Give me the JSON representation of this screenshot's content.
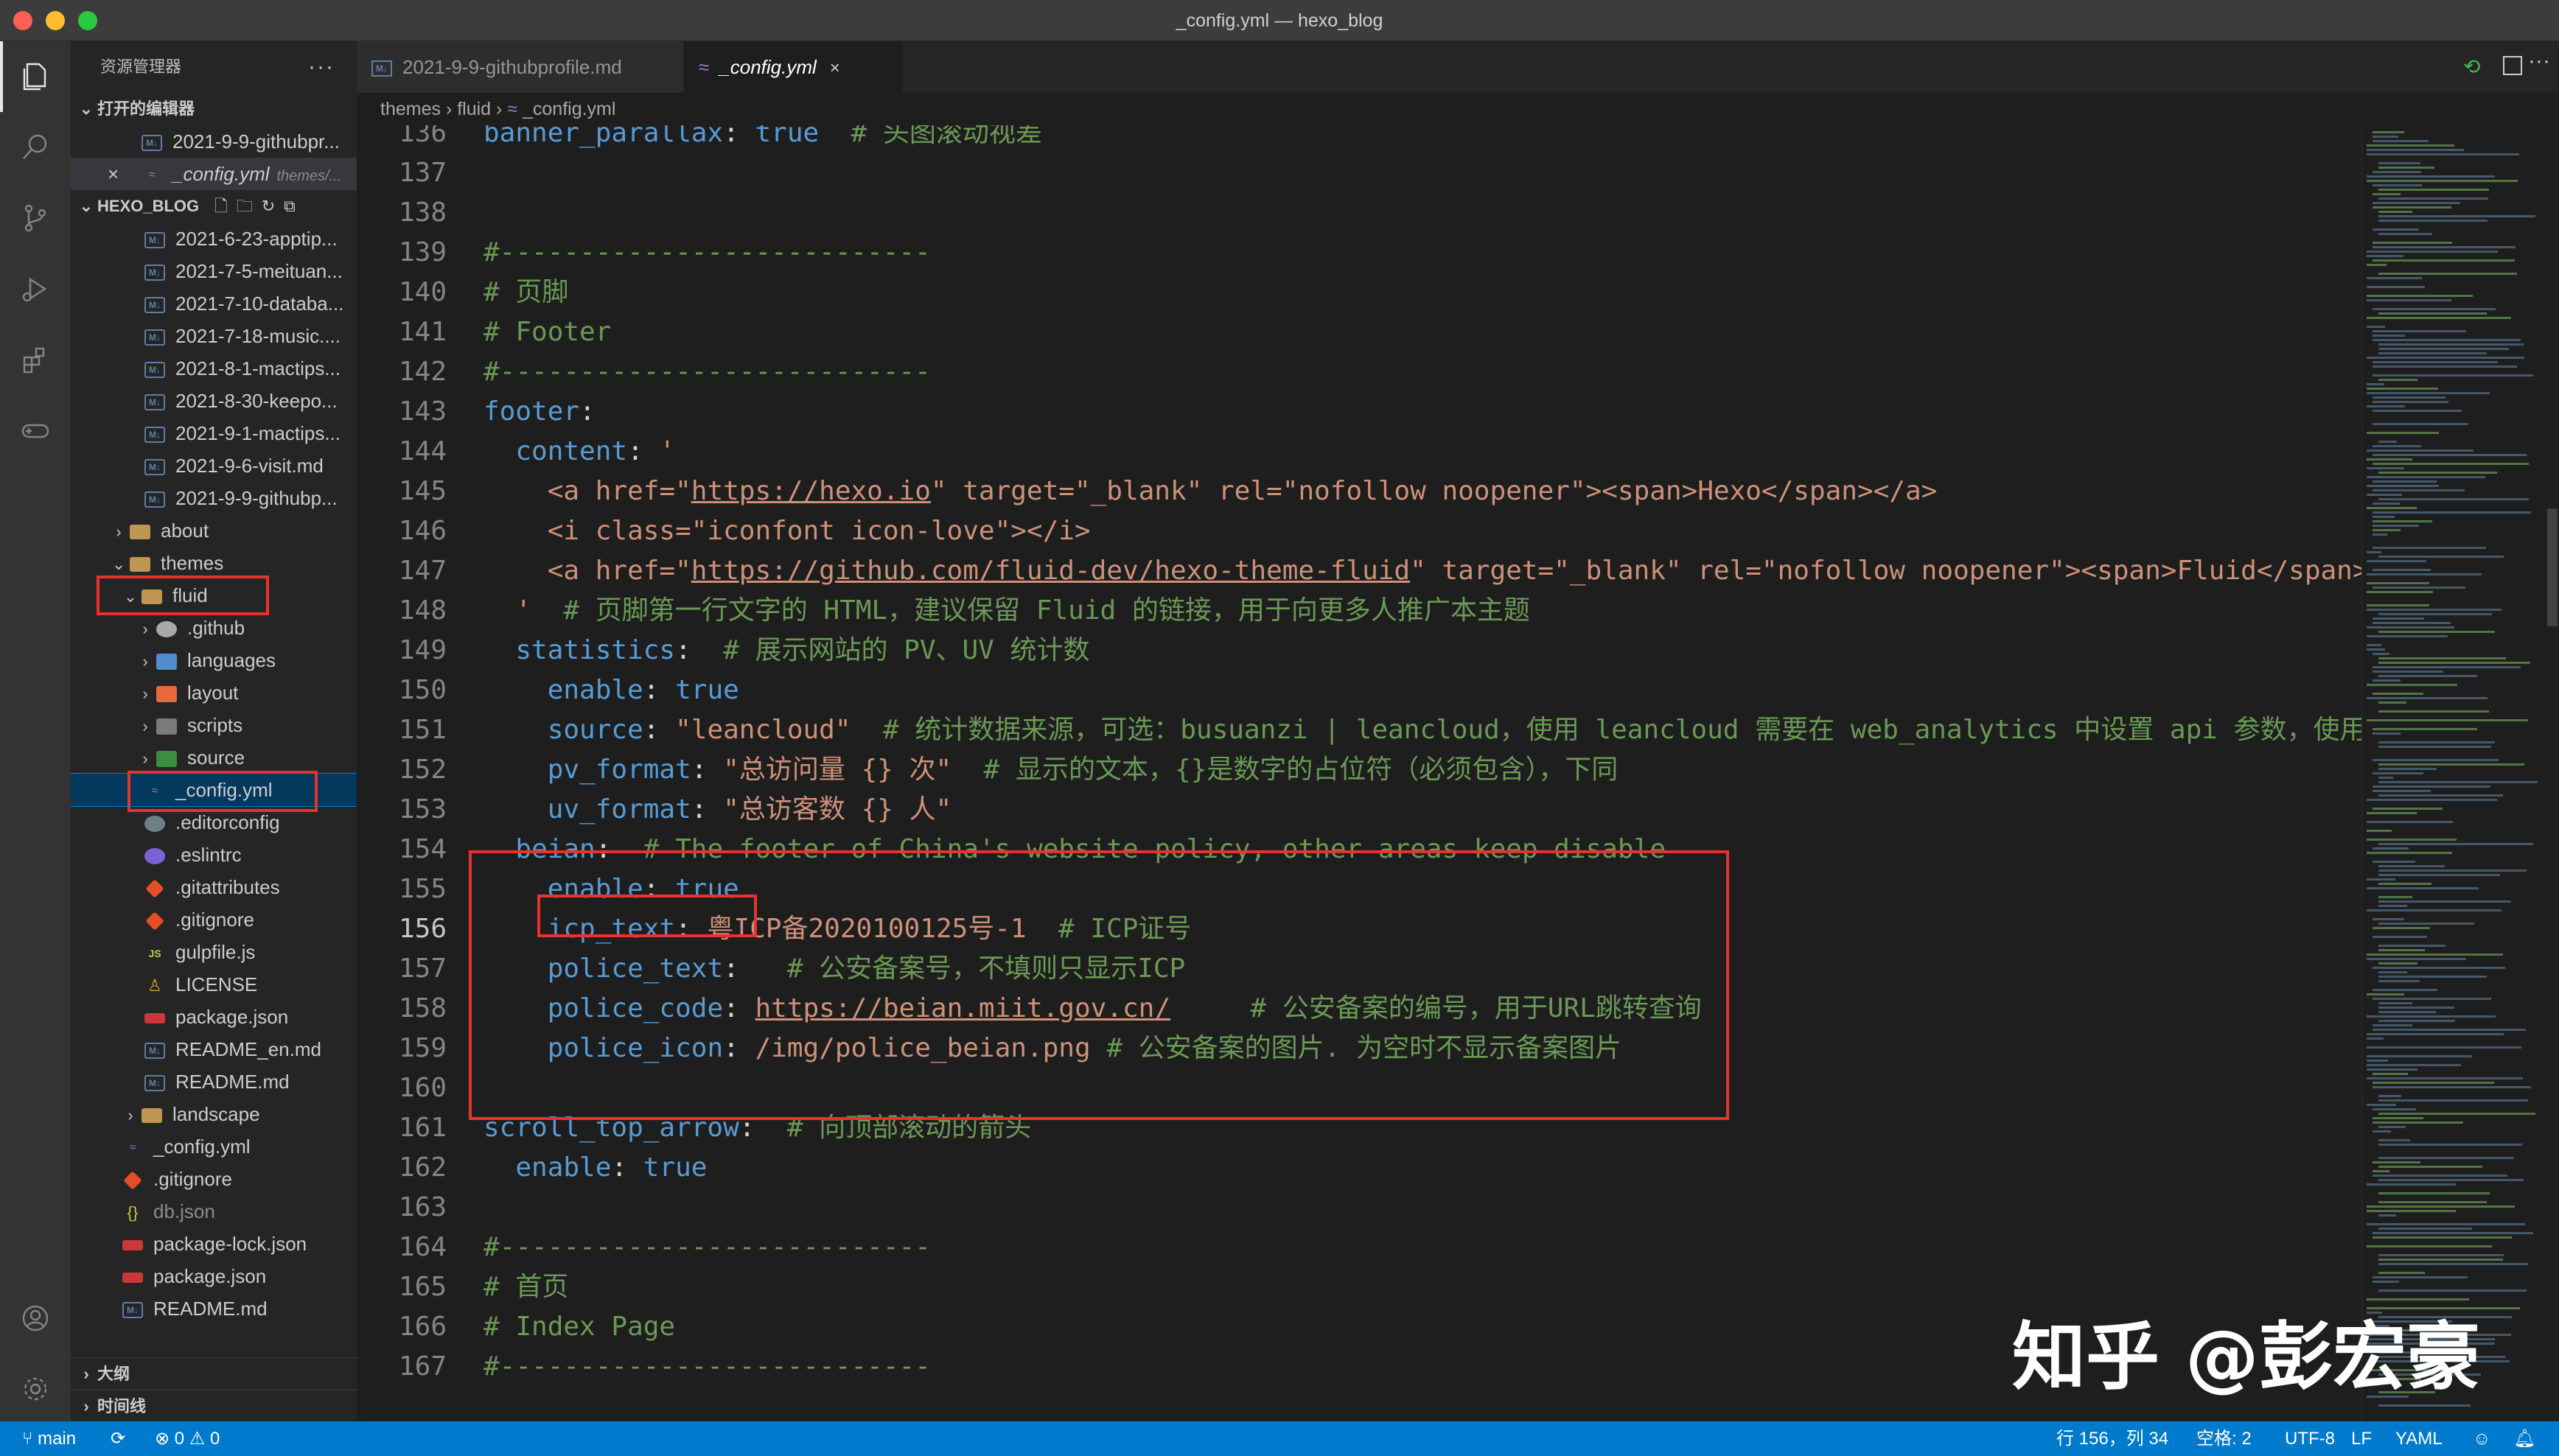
{
  "window": {
    "title": "_config.yml — hexo_blog"
  },
  "sidebar": {
    "title": "资源管理器",
    "open_editors_label": "打开的编辑器",
    "open_editors": [
      {
        "name": "2021-9-9-githubpr...",
        "note": ""
      },
      {
        "name": "_config.yml",
        "note": "themes/..."
      }
    ],
    "project_label": "HEXO_BLOG",
    "files": [
      "2021-6-23-apptip...",
      "2021-7-5-meituan...",
      "2021-7-10-databa...",
      "2021-7-18-music....",
      "2021-8-1-mactips...",
      "2021-8-30-keepo...",
      "2021-9-1-mactips...",
      "2021-9-6-visit.md",
      "2021-9-9-githubp...",
      "about",
      "themes",
      "fluid",
      ".github",
      "languages",
      "layout",
      "scripts",
      "source",
      "_config.yml",
      ".editorconfig",
      ".eslintrc",
      ".gitattributes",
      ".gitignore",
      "gulpfile.js",
      "LICENSE",
      "package.json",
      "README_en.md",
      "README.md",
      "landscape",
      "_config.yml",
      ".gitignore",
      "db.json",
      "package-lock.json",
      "package.json",
      "README.md"
    ],
    "outline_label": "大纲",
    "timeline_label": "时间线"
  },
  "tabs": [
    {
      "label": "2021-9-9-githubprofile.md"
    },
    {
      "label": "_config.yml",
      "close": "×"
    }
  ],
  "breadcrumb": [
    "themes",
    "fluid",
    "_config.yml"
  ],
  "editor": {
    "current_line": 156,
    "lines": [
      {
        "n": "136",
        "t": [
          [
            "k",
            "banner_parallax"
          ],
          [
            "p",
            ": "
          ],
          [
            "b",
            "true"
          ],
          [
            "p",
            "  "
          ],
          [
            "c",
            "# 头图滚动视差"
          ]
        ]
      },
      {
        "n": "137",
        "t": []
      },
      {
        "n": "138",
        "t": []
      },
      {
        "n": "139",
        "t": [
          [
            "c",
            "#---------------------------"
          ]
        ]
      },
      {
        "n": "140",
        "t": [
          [
            "c",
            "# 页脚"
          ]
        ]
      },
      {
        "n": "141",
        "t": [
          [
            "c",
            "# Footer"
          ]
        ]
      },
      {
        "n": "142",
        "t": [
          [
            "c",
            "#---------------------------"
          ]
        ]
      },
      {
        "n": "143",
        "t": [
          [
            "k",
            "footer"
          ],
          [
            "p",
            ":"
          ]
        ]
      },
      {
        "n": "144",
        "t": [
          [
            "p",
            "  "
          ],
          [
            "k",
            "content"
          ],
          [
            "p",
            ": "
          ],
          [
            "s",
            "'"
          ]
        ]
      },
      {
        "n": "145",
        "t": [
          [
            "s",
            "    <a href=\""
          ],
          [
            "u",
            "https://hexo.io"
          ],
          [
            "s",
            "\" target=\"_blank\" rel=\"nofollow noopener\"><span>Hexo</span></a>"
          ]
        ]
      },
      {
        "n": "146",
        "t": [
          [
            "s",
            "    <i class=\"iconfont icon-love\"></i>"
          ]
        ]
      },
      {
        "n": "147",
        "t": [
          [
            "s",
            "    <a href=\""
          ],
          [
            "u",
            "https://github.com/fluid-dev/hexo-theme-fluid"
          ],
          [
            "s",
            "\" target=\"_blank\" rel=\"nofollow noopener\"><span>Fluid</span></a>"
          ]
        ]
      },
      {
        "n": "148",
        "t": [
          [
            "s",
            "  '"
          ],
          [
            "p",
            "  "
          ],
          [
            "c",
            "# 页脚第一行文字的 HTML，建议保留 Fluid 的链接，用于向更多人推广本主题"
          ]
        ]
      },
      {
        "n": "149",
        "t": [
          [
            "p",
            "  "
          ],
          [
            "k",
            "statistics"
          ],
          [
            "p",
            ":  "
          ],
          [
            "c",
            "# 展示网站的 PV、UV 统计数"
          ]
        ]
      },
      {
        "n": "150",
        "t": [
          [
            "p",
            "    "
          ],
          [
            "k",
            "enable"
          ],
          [
            "p",
            ": "
          ],
          [
            "b",
            "true"
          ]
        ]
      },
      {
        "n": "151",
        "t": [
          [
            "p",
            "    "
          ],
          [
            "k",
            "source"
          ],
          [
            "p",
            ": "
          ],
          [
            "s",
            "\"leancloud\""
          ],
          [
            "p",
            "  "
          ],
          [
            "c",
            "# 统计数据来源，可选：busuanzi | leancloud，使用 leancloud 需要在 web_analytics 中设置 api 参数，使用 busuanzi 不需要额外设置"
          ]
        ]
      },
      {
        "n": "152",
        "t": [
          [
            "p",
            "    "
          ],
          [
            "k",
            "pv_format"
          ],
          [
            "p",
            ": "
          ],
          [
            "s",
            "\"总访问量 {} 次\""
          ],
          [
            "p",
            "  "
          ],
          [
            "c",
            "# 显示的文本，{}是数字的占位符（必须包含），下同"
          ]
        ]
      },
      {
        "n": "153",
        "t": [
          [
            "p",
            "    "
          ],
          [
            "k",
            "uv_format"
          ],
          [
            "p",
            ": "
          ],
          [
            "s",
            "\"总访客数 {} 人\""
          ]
        ]
      },
      {
        "n": "154",
        "t": [
          [
            "p",
            "  "
          ],
          [
            "k",
            "beian"
          ],
          [
            "p",
            ":  "
          ],
          [
            "c",
            "# The footer of China's website policy, other areas keep disable"
          ]
        ]
      },
      {
        "n": "155",
        "t": [
          [
            "p",
            "    "
          ],
          [
            "k",
            "enable"
          ],
          [
            "p",
            ": "
          ],
          [
            "b",
            "true"
          ]
        ]
      },
      {
        "n": "156",
        "t": [
          [
            "p",
            "    "
          ],
          [
            "k",
            "icp_text"
          ],
          [
            "p",
            ": "
          ],
          [
            "s",
            "粤ICP备2020100125号-1"
          ],
          [
            "p",
            "  "
          ],
          [
            "c",
            "# ICP证号"
          ]
        ]
      },
      {
        "n": "157",
        "t": [
          [
            "p",
            "    "
          ],
          [
            "k",
            "police_text"
          ],
          [
            "p",
            ":   "
          ],
          [
            "c",
            "# 公安备案号，不填则只显示ICP"
          ]
        ]
      },
      {
        "n": "158",
        "t": [
          [
            "p",
            "    "
          ],
          [
            "k",
            "police_code"
          ],
          [
            "p",
            ": "
          ],
          [
            "u",
            "https://beian.miit.gov.cn/"
          ],
          [
            "p",
            "     "
          ],
          [
            "c",
            "# 公安备案的编号，用于URL跳转查询"
          ]
        ]
      },
      {
        "n": "159",
        "t": [
          [
            "p",
            "    "
          ],
          [
            "k",
            "police_icon"
          ],
          [
            "p",
            ": "
          ],
          [
            "s",
            "/img/police_beian.png"
          ],
          [
            "p",
            " "
          ],
          [
            "c",
            "# 公安备案的图片. 为空时不显示备案图片"
          ]
        ]
      },
      {
        "n": "160",
        "t": []
      },
      {
        "n": "161",
        "t": [
          [
            "k",
            "scroll_top_arrow"
          ],
          [
            "p",
            ":  "
          ],
          [
            "c",
            "# 向顶部滚动的箭头"
          ]
        ]
      },
      {
        "n": "162",
        "t": [
          [
            "p",
            "  "
          ],
          [
            "k",
            "enable"
          ],
          [
            "p",
            ": "
          ],
          [
            "b",
            "true"
          ]
        ]
      },
      {
        "n": "163",
        "t": []
      },
      {
        "n": "164",
        "t": [
          [
            "c",
            "#---------------------------"
          ]
        ]
      },
      {
        "n": "165",
        "t": [
          [
            "c",
            "# 首页"
          ]
        ]
      },
      {
        "n": "166",
        "t": [
          [
            "c",
            "# Index Page"
          ]
        ]
      },
      {
        "n": "167",
        "t": [
          [
            "c",
            "#---------------------------"
          ]
        ]
      }
    ]
  },
  "statusbar": {
    "branch": "main",
    "errors": "0",
    "warnings": "0",
    "position": "行 156，列 34",
    "spaces": "空格: 2",
    "encoding": "UTF-8",
    "eol": "LF",
    "language": "YAML"
  },
  "watermark": "知乎 @彭宏豪",
  "colors": {
    "accent": "#007acc",
    "highlight_box": "#e8322e"
  }
}
